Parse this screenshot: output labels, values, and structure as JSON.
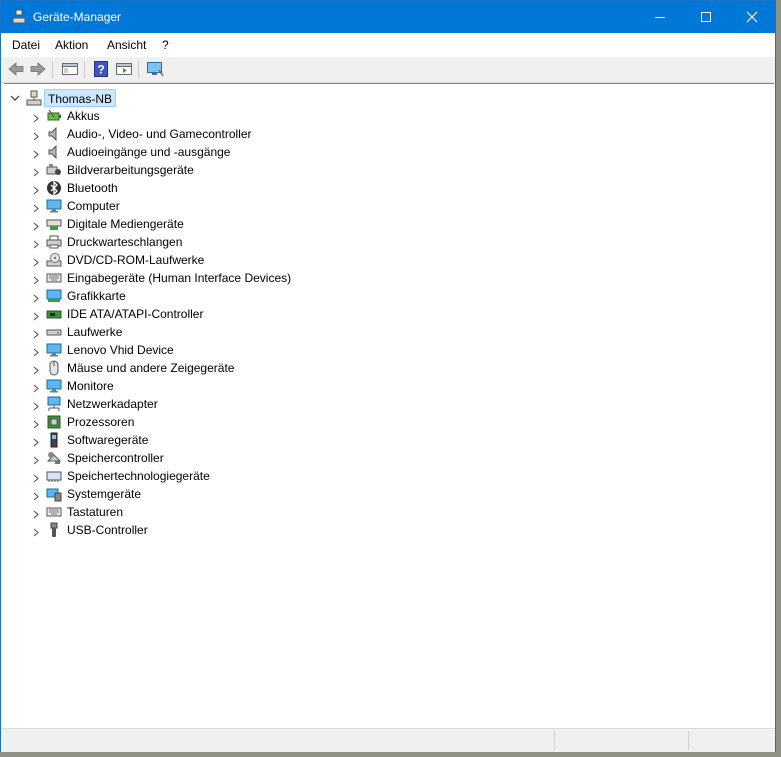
{
  "window": {
    "title": "Geräte-Manager",
    "accent": "#0078d7"
  },
  "menu": [
    "Datei",
    "Aktion",
    "Ansicht",
    "?"
  ],
  "toolbar": {
    "buttons": [
      "back-icon",
      "forward-icon",
      "properties-view-icon",
      "help-icon",
      "show-hide-tree-icon",
      "scan-hardware-icon"
    ]
  },
  "tree": {
    "root": {
      "label": "Thomas-NB",
      "expanded": true,
      "selected": true
    },
    "nodes": [
      {
        "label": "Akkus",
        "icon": "battery-icon"
      },
      {
        "label": "Audio-, Video- und Gamecontroller",
        "icon": "speaker-icon"
      },
      {
        "label": "Audioeingänge und -ausgänge",
        "icon": "speaker-icon"
      },
      {
        "label": "Bildverarbeitungsgeräte",
        "icon": "camera-icon"
      },
      {
        "label": "Bluetooth",
        "icon": "bluetooth-icon"
      },
      {
        "label": "Computer",
        "icon": "monitor-icon"
      },
      {
        "label": "Digitale Mediengeräte",
        "icon": "media-device-icon"
      },
      {
        "label": "Druckwarteschlangen",
        "icon": "printer-icon"
      },
      {
        "label": "DVD/CD-ROM-Laufwerke",
        "icon": "disc-drive-icon"
      },
      {
        "label": "Eingabegeräte (Human Interface Devices)",
        "icon": "keyboard-icon"
      },
      {
        "label": "Grafikkarte",
        "icon": "display-adapter-icon"
      },
      {
        "label": "IDE ATA/ATAPI-Controller",
        "icon": "controller-card-icon"
      },
      {
        "label": "Laufwerke",
        "icon": "drive-icon"
      },
      {
        "label": "Lenovo Vhid Device",
        "icon": "monitor-icon"
      },
      {
        "label": "Mäuse und andere Zeigegeräte",
        "icon": "mouse-icon"
      },
      {
        "label": "Monitore",
        "icon": "monitor-icon"
      },
      {
        "label": "Netzwerkadapter",
        "icon": "network-icon"
      },
      {
        "label": "Prozessoren",
        "icon": "cpu-icon"
      },
      {
        "label": "Softwaregeräte",
        "icon": "software-device-icon"
      },
      {
        "label": "Speichercontroller",
        "icon": "storage-controller-icon"
      },
      {
        "label": "Speichertechnologiegeräte",
        "icon": "memory-device-icon"
      },
      {
        "label": "Systemgeräte",
        "icon": "system-device-icon"
      },
      {
        "label": "Tastaturen",
        "icon": "keyboard-icon"
      },
      {
        "label": "USB-Controller",
        "icon": "usb-icon"
      }
    ]
  }
}
